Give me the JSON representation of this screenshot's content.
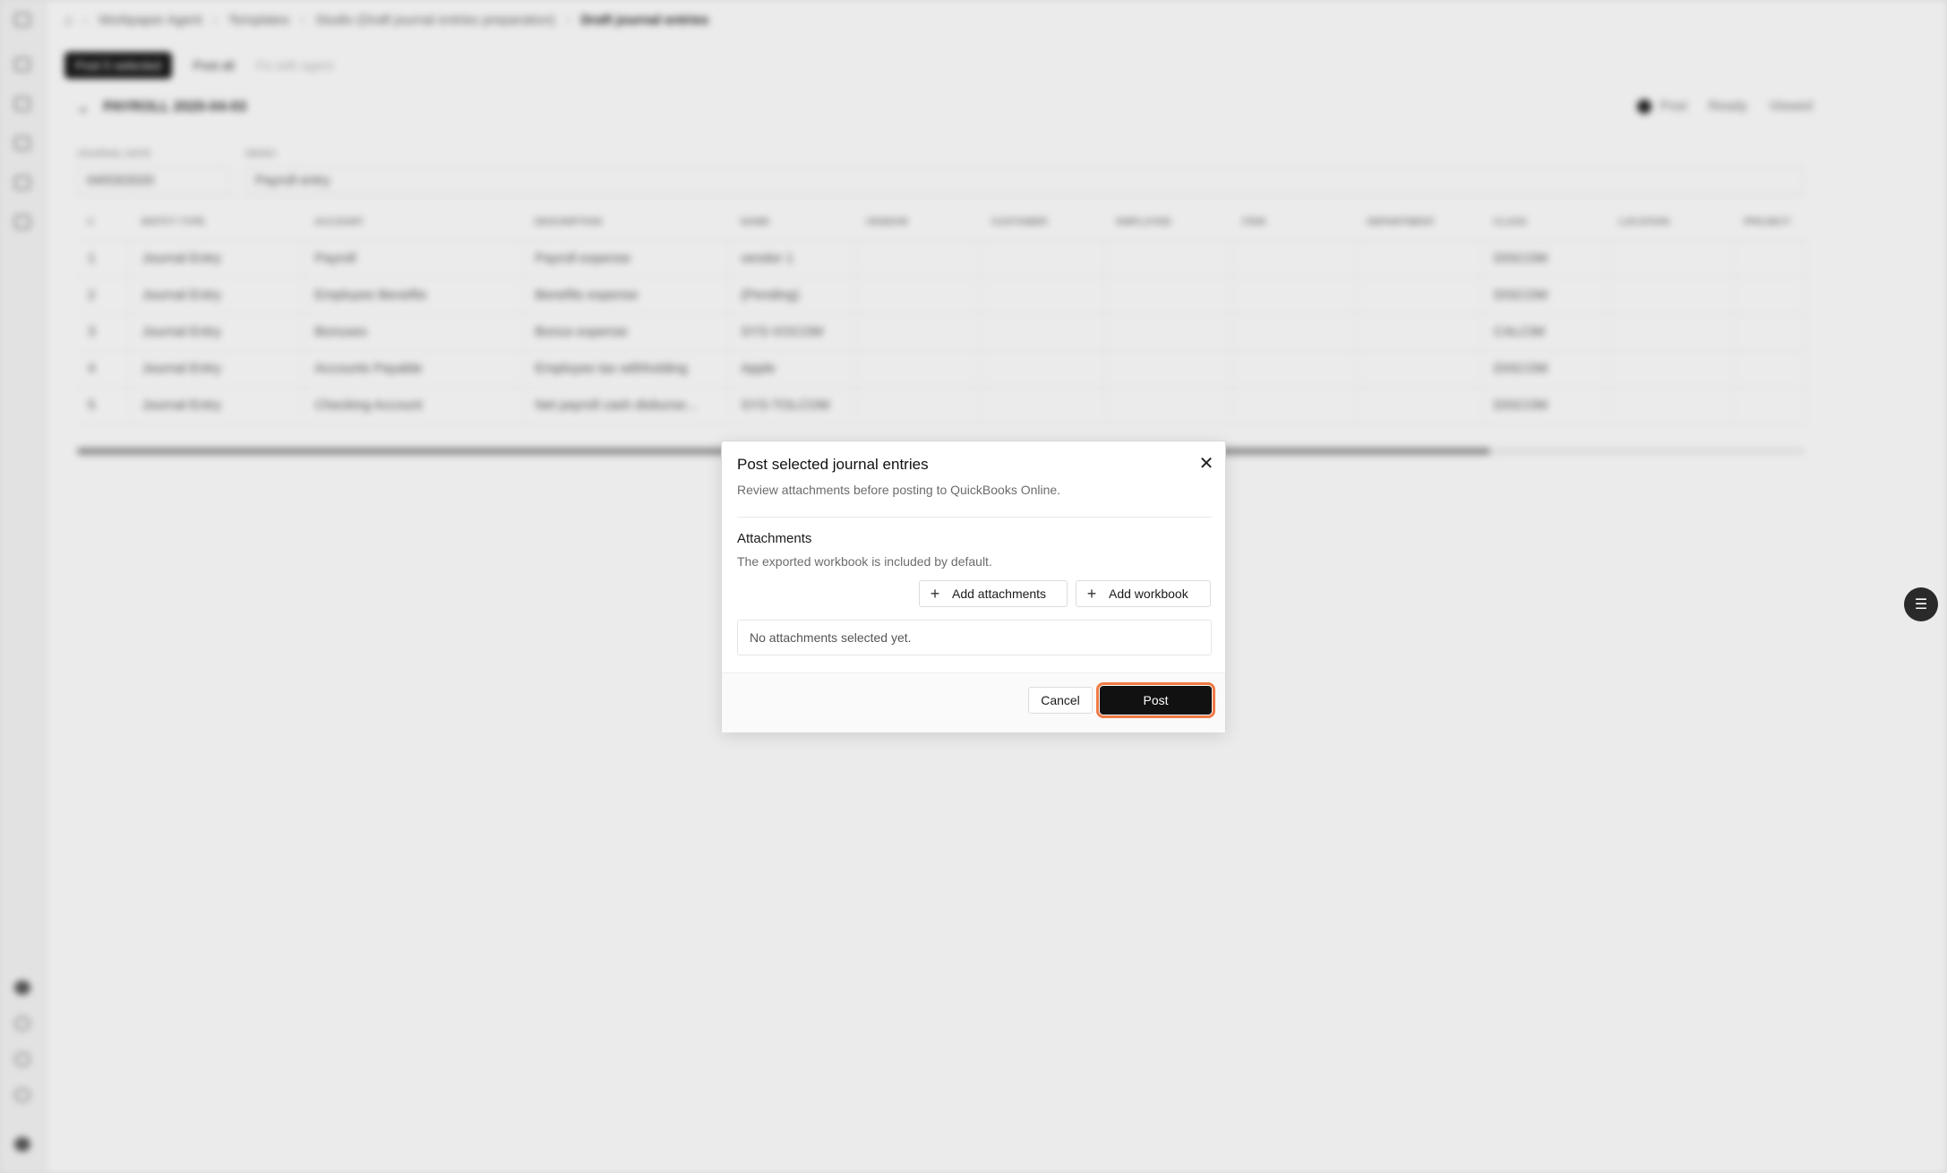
{
  "breadcrumb": [
    "Workpaper Agent",
    "Templates",
    "Studio (Draft journal entries preparation)",
    "Draft journal entries"
  ],
  "toolbar": {
    "primary_label": "Post 5 selected",
    "secondary_label": "Post all",
    "muted_label": "Fix with agent"
  },
  "journal_entry": {
    "title": "PAYROLL 2020-04-03",
    "status_tabs": [
      "Post",
      "Ready",
      "Viewed"
    ],
    "date_label": "JOURNAL DATE",
    "date_value": "04/03/2020",
    "memo_label": "MEMO",
    "memo_value": "Payroll entry"
  },
  "table": {
    "columns": [
      "#",
      "Entity type",
      "Account",
      "Description",
      "Name",
      "Vendor",
      "Customer",
      "Employee",
      "Item",
      "Department",
      "Class",
      "Location",
      "Project"
    ],
    "rows": [
      [
        "1",
        "Journal Entry",
        "Payroll",
        "Payroll expense",
        "vendor 1",
        "",
        "",
        "",
        "",
        "",
        "DISCOM",
        "",
        ""
      ],
      [
        "2",
        "Journal Entry",
        "Employee Benefits",
        "Benefits expense",
        "(Pending)",
        "",
        "",
        "",
        "",
        "",
        "DISCOM",
        "",
        ""
      ],
      [
        "3",
        "Journal Entry",
        "Bonuses",
        "Bonus expense",
        "SYS-VOCOM",
        "",
        "",
        "",
        "",
        "",
        "CALCIM",
        "",
        ""
      ],
      [
        "4",
        "Journal Entry",
        "Accounts Payable",
        "Employee tax withholding",
        "Apple",
        "",
        "",
        "",
        "",
        "",
        "DISCOM",
        "",
        ""
      ],
      [
        "5",
        "Journal Entry",
        "Checking Account",
        "Net payroll cash disburse...",
        "SYS-TOLCOM",
        "",
        "",
        "",
        "",
        "",
        "DISCOM",
        "",
        ""
      ]
    ]
  },
  "modal": {
    "title": "Post selected journal entries",
    "subtitle": "Review attachments before posting to QuickBooks Online.",
    "attachments_heading": "Attachments",
    "attachments_desc": "The exported workbook is included by default.",
    "add_attachments_label": "Add attachments",
    "add_workbook_label": "Add workbook",
    "empty_text": "No attachments selected yet.",
    "cancel_label": "Cancel",
    "post_label": "Post",
    "close_glyph": "✕"
  },
  "colors": {
    "accent_outline": "#f07a45",
    "primary_button": "#111111"
  }
}
